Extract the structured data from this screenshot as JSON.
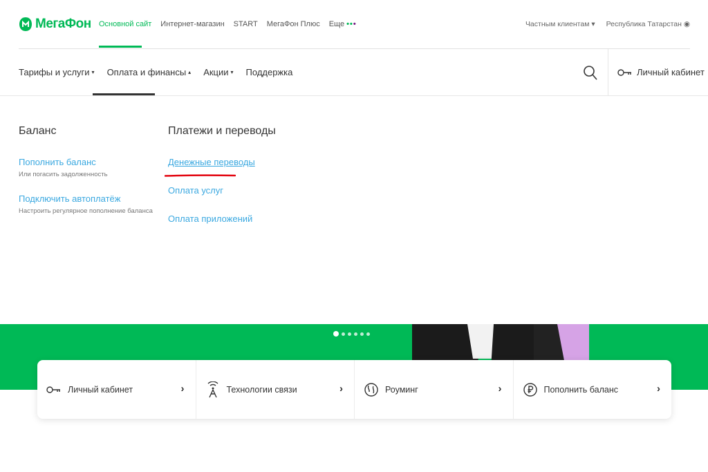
{
  "header": {
    "logo_text": "МегаФон",
    "top_links": [
      {
        "label": "Основной сайт",
        "active": true
      },
      {
        "label": "Интернет-магазин",
        "active": false
      },
      {
        "label": "START",
        "active": false
      },
      {
        "label": "МегаФон Плюс",
        "active": false
      },
      {
        "label": "Еще",
        "active": false
      }
    ],
    "more_dots": "••",
    "more_dot_purple": "•",
    "segment": "Частным клиентам ▾",
    "region": "Республика Татарстан ◉"
  },
  "nav": {
    "items": [
      {
        "label": "Тарифы и услуги",
        "caret": "▾"
      },
      {
        "label": "Оплата и финансы",
        "caret": "▴"
      },
      {
        "label": "Акции",
        "caret": "▾"
      },
      {
        "label": "Поддержка",
        "caret": ""
      }
    ],
    "cabinet_label": "Личный кабинет"
  },
  "menu": {
    "col1": {
      "title": "Баланс",
      "items": [
        {
          "label": "Пополнить баланс",
          "sub": "Или погасить задолженность"
        },
        {
          "label": "Подключить автоплатёж",
          "sub": "Настроить регулярное пополнение баланса"
        }
      ]
    },
    "col2": {
      "title": "Платежи и переводы",
      "items": [
        {
          "label": "Денежные переводы"
        },
        {
          "label": "Оплата услуг"
        },
        {
          "label": "Оплата приложений"
        }
      ]
    }
  },
  "cards": [
    {
      "label": "Личный кабинет",
      "icon": "key-icon",
      "chevron": "›"
    },
    {
      "label": "Технологии связи",
      "icon": "antenna-icon",
      "chevron": "›"
    },
    {
      "label": "Роуминг",
      "icon": "roaming-icon",
      "chevron": "›"
    },
    {
      "label": "Пополнить баланс",
      "icon": "ruble-icon",
      "chevron": "›"
    }
  ],
  "colors": {
    "brand_green": "#00b956",
    "link_blue": "#3aa8e0",
    "highlight_red": "#e30611",
    "purple": "#731982"
  }
}
